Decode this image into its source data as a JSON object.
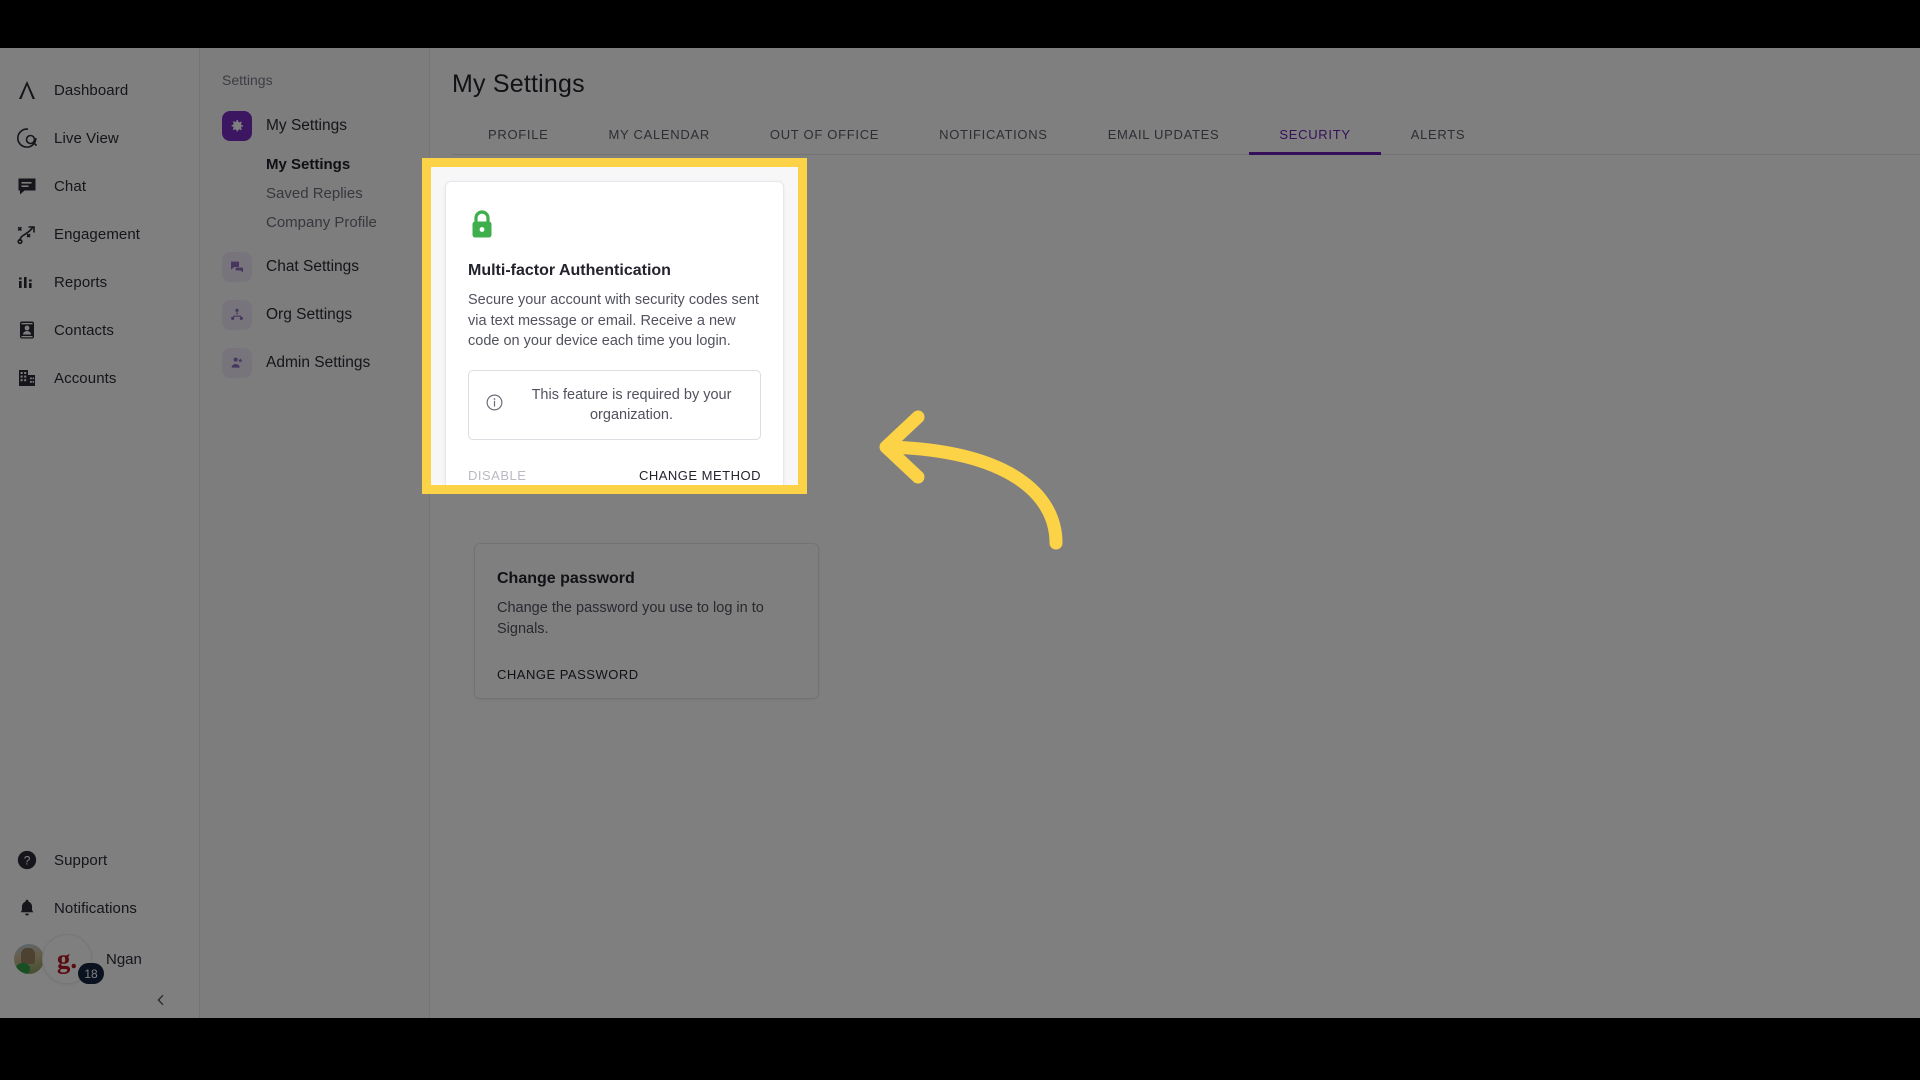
{
  "window": {
    "title": "My Settings"
  },
  "rail": {
    "items": [
      {
        "label": "Dashboard",
        "icon": "logo-chevron-icon"
      },
      {
        "label": "Live View",
        "icon": "live-view-icon"
      },
      {
        "label": "Chat",
        "icon": "chat-icon"
      },
      {
        "label": "Engagement",
        "icon": "engagement-icon"
      },
      {
        "label": "Reports",
        "icon": "reports-icon"
      },
      {
        "label": "Contacts",
        "icon": "contacts-icon"
      },
      {
        "label": "Accounts",
        "icon": "accounts-icon"
      }
    ],
    "bottom": [
      {
        "label": "Support",
        "icon": "help-circle-icon"
      },
      {
        "label": "Notifications",
        "icon": "bell-icon"
      }
    ],
    "user": {
      "name": "Ngan",
      "badge_count": "18",
      "brand_mark": "g."
    },
    "collapse_icon": "chevron-left-icon"
  },
  "settings_nav": {
    "title": "Settings",
    "groups": [
      {
        "label": "My Settings",
        "icon": "gear-icon",
        "active": true,
        "children": [
          "My Settings",
          "Saved Replies",
          "Company Profile"
        ],
        "current_child": "My Settings"
      },
      {
        "label": "Chat Settings",
        "icon": "chat-bubbles-icon",
        "active": false
      },
      {
        "label": "Org Settings",
        "icon": "org-people-icon",
        "active": false
      },
      {
        "label": "Admin Settings",
        "icon": "admin-person-icon",
        "active": false
      }
    ]
  },
  "main": {
    "page_title": "My Settings",
    "tabs": [
      {
        "label": "PROFILE",
        "active": false
      },
      {
        "label": "MY CALENDAR",
        "active": false
      },
      {
        "label": "OUT OF OFFICE",
        "active": false
      },
      {
        "label": "NOTIFICATIONS",
        "active": false
      },
      {
        "label": "EMAIL UPDATES",
        "active": false
      },
      {
        "label": "SECURITY",
        "active": true
      },
      {
        "label": "ALERTS",
        "active": false
      }
    ],
    "mfa_card": {
      "icon": "green-lock-icon",
      "title": "Multi-factor Authentication",
      "description": "Secure your account with security codes sent via text message or email. Receive a new code on your device each time you login.",
      "notice_icon": "info-circle-icon",
      "notice": "This feature is required by your organization.",
      "disable_label": "DISABLE",
      "change_method_label": "CHANGE METHOD"
    },
    "password_card": {
      "title": "Change password",
      "description": "Change the password you use to log in to Signals.",
      "action_label": "CHANGE PASSWORD"
    }
  },
  "annotation": {
    "highlight_color": "#FCD246",
    "arrow": "curved-left-arrow",
    "arrow_color": "#FCD246"
  },
  "colors": {
    "accent_purple": "#6a1fb5",
    "lock_green": "#3fae4c",
    "highlight_yellow": "#FCD246",
    "badge_navy": "#15233f"
  }
}
